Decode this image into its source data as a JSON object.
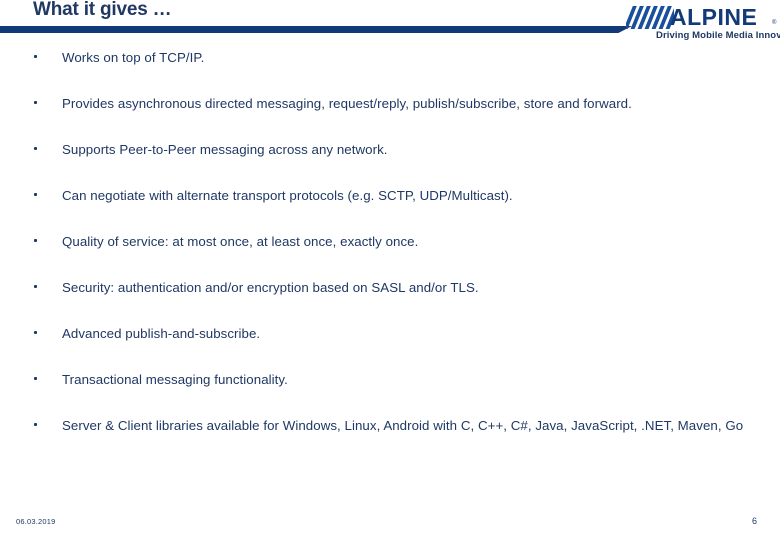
{
  "header": {
    "title": "What it gives …",
    "rule_color": "#123A78"
  },
  "logo": {
    "wordmark": "ALPINE",
    "registered_mark": "®",
    "tagline": "Driving Mobile Media Innovation",
    "color": "#123A78",
    "stripe_color": "#1A4F9C"
  },
  "body": {
    "text_color": "#1F3864",
    "bullets": [
      {
        "text": "Works on top of TCP/IP."
      },
      {
        "text": "Provides asynchronous directed messaging, request/reply, publish/subscribe, store and forward."
      },
      {
        "text": "Supports Peer-to-Peer messaging across any network."
      },
      {
        "text": "Can negotiate with alternate transport protocols (e.g. SCTP, UDP/Multicast)."
      },
      {
        "text": "Quality of service: at most once, at least once, exactly once."
      },
      {
        "text": "Security: authentication and/or encryption based on SASL and/or TLS."
      },
      {
        "text": "Advanced publish-and-subscribe."
      },
      {
        "text": "Transactional messaging functionality."
      },
      {
        "text": "Server & Client libraries available for Windows, Linux, Android with C, C++, C#, Java, JavaScript, .NET, Maven, Go"
      }
    ]
  },
  "footer": {
    "date": "06.03.2019",
    "page_number": "6"
  }
}
